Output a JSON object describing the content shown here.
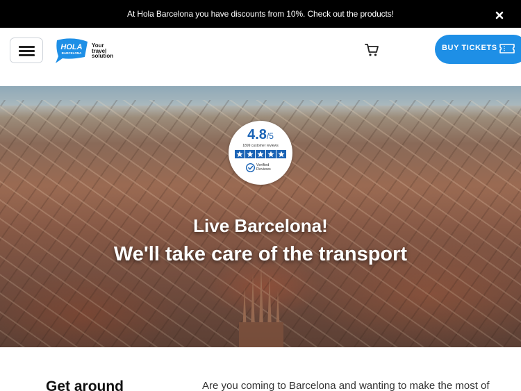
{
  "announcement": {
    "text": "At Hola Barcelona you have discounts from 10%. Check out the products!",
    "close_icon": "close-icon"
  },
  "header": {
    "menu_icon": "hamburger-menu-icon",
    "logo": {
      "badge_text": "HOLA",
      "badge_subtext": "BARCELONA",
      "tagline_line1": "Your",
      "tagline_line2": "travel",
      "tagline_line3": "solution"
    },
    "cart_icon": "cart-icon",
    "buy_button_label": "BUY TICKETS",
    "buy_button_icon": "ticket-icon"
  },
  "hero": {
    "rating": {
      "score": "4.8",
      "out_of": "/5",
      "count": "1899 customer reviews",
      "stars": 5,
      "verified_line1": "Verified",
      "verified_line2": "Reviews"
    },
    "headline_line1": "Live Barcelona!",
    "headline_line2": "We'll take care of the transport"
  },
  "intro": {
    "title": "Get around",
    "text": "Are you coming to Barcelona and wanting to make the most of"
  },
  "colors": {
    "brand_blue": "#1e8fe6",
    "rating_blue": "#1a63b5",
    "topbar_bg": "#000000"
  }
}
